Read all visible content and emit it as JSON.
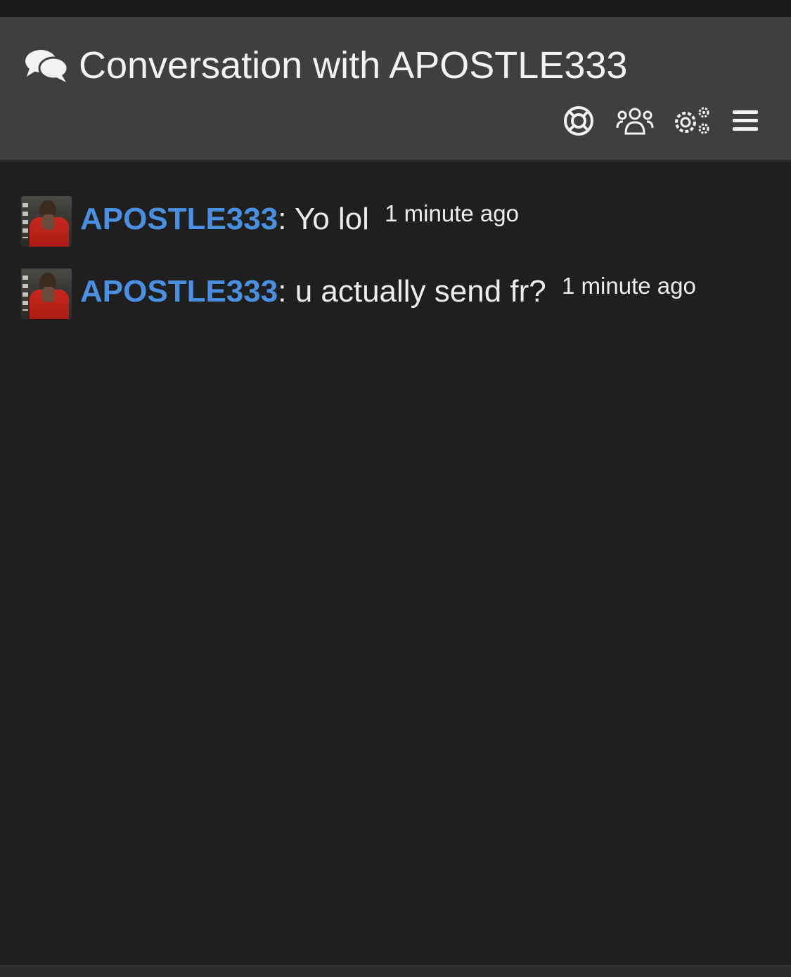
{
  "header": {
    "title": "Conversation with APOSTLE333",
    "title_icon": "chat-bubbles-icon",
    "toolbar": [
      {
        "name": "support-button",
        "icon": "lifebuoy-icon"
      },
      {
        "name": "participants-button",
        "icon": "users-icon"
      },
      {
        "name": "settings-button",
        "icon": "gears-icon"
      },
      {
        "name": "menu-button",
        "icon": "hamburger-menu-icon"
      }
    ]
  },
  "messages": [
    {
      "username": "APOSTLE333",
      "separator": ":",
      "text": "Yo lol",
      "time": "1 minute ago"
    },
    {
      "username": "APOSTLE333",
      "separator": ":",
      "text": "u actually send fr?",
      "time": "1 minute ago"
    }
  ],
  "colors": {
    "username": "#4a8fe0",
    "header_bg": "#3f3f3f",
    "page_bg": "#1f1f1f",
    "text": "#ececec"
  }
}
